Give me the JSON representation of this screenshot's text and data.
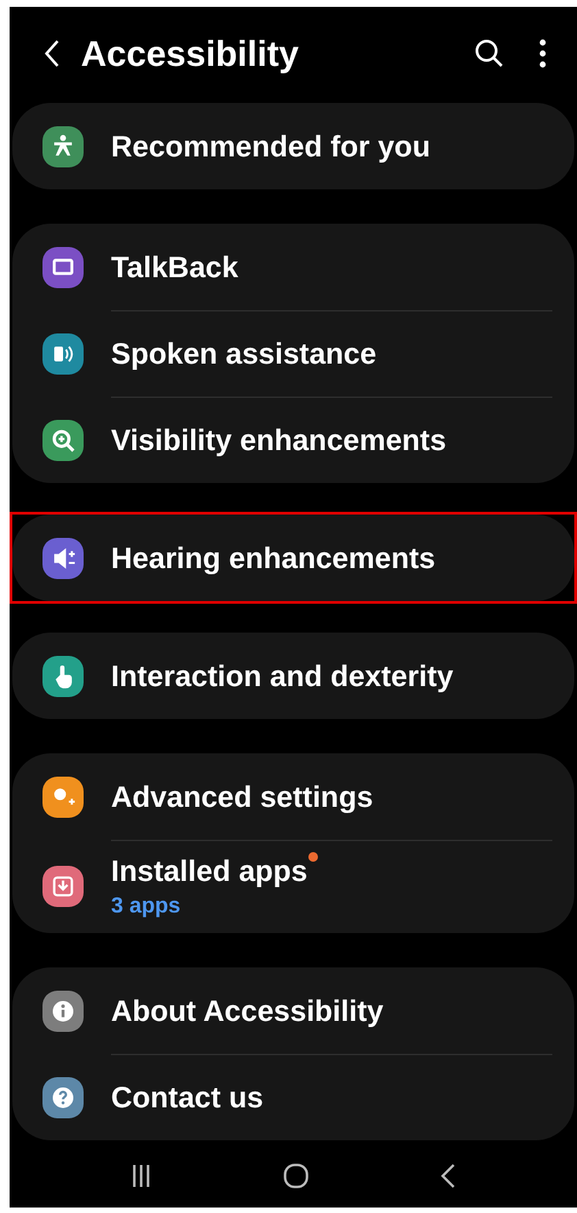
{
  "header": {
    "title": "Accessibility"
  },
  "groups": [
    {
      "highlighted": false,
      "items": [
        {
          "label": "Recommended for you",
          "color": "#3f8f5a"
        }
      ]
    },
    {
      "highlighted": false,
      "items": [
        {
          "label": "TalkBack",
          "color": "#7b4fc4"
        },
        {
          "label": "Spoken assistance",
          "color": "#1f8aa0"
        },
        {
          "label": "Visibility enhancements",
          "color": "#3a9a5c"
        }
      ]
    },
    {
      "highlighted": true,
      "items": [
        {
          "label": "Hearing enhancements",
          "color": "#6a5fd0"
        }
      ]
    },
    {
      "highlighted": false,
      "items": [
        {
          "label": "Interaction and dexterity",
          "color": "#23a08a"
        }
      ]
    },
    {
      "highlighted": false,
      "items": [
        {
          "label": "Advanced settings",
          "color": "#f0901e"
        },
        {
          "label": "Installed apps",
          "sublabel": "3 apps",
          "new_badge": true,
          "color": "#e06a7a"
        }
      ]
    },
    {
      "highlighted": false,
      "items": [
        {
          "label": "About Accessibility",
          "color": "#7d7d7d"
        },
        {
          "label": "Contact us",
          "color": "#5d88a8"
        }
      ]
    }
  ]
}
